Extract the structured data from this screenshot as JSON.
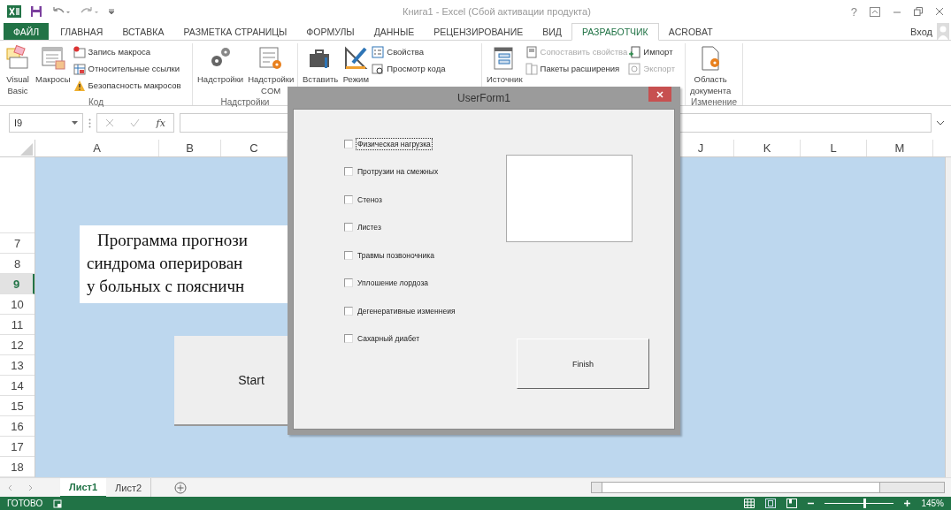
{
  "window": {
    "title": "Книга1 - Excel (Сбой активации продукта)",
    "help": "?"
  },
  "ribbon_tabs": [
    {
      "label": "ФАЙЛ",
      "kind": "file",
      "selected": false
    },
    {
      "label": "ГЛАВНАЯ",
      "kind": "tab",
      "selected": false
    },
    {
      "label": "ВСТАВКА",
      "kind": "tab",
      "selected": false
    },
    {
      "label": "РАЗМЕТКА СТРАНИЦЫ",
      "kind": "tab",
      "selected": false
    },
    {
      "label": "ФОРМУЛЫ",
      "kind": "tab",
      "selected": false
    },
    {
      "label": "ДАННЫЕ",
      "kind": "tab",
      "selected": false
    },
    {
      "label": "РЕЦЕНЗИРОВАНИЕ",
      "kind": "tab",
      "selected": false
    },
    {
      "label": "ВИД",
      "kind": "tab",
      "selected": false
    },
    {
      "label": "РАЗРАБОТЧИК",
      "kind": "tab",
      "selected": true
    },
    {
      "label": "ACROBAT",
      "kind": "tab",
      "selected": false
    }
  ],
  "account": {
    "label": "Вход"
  },
  "ribbon_groups": [
    {
      "label": "Код",
      "items": [
        {
          "kind": "large",
          "label": "Visual Basic",
          "disabled": false
        },
        {
          "kind": "large",
          "label": "Макросы",
          "disabled": false
        },
        {
          "kind": "stack",
          "children": [
            {
              "label": "Запись макроса",
              "disabled": false
            },
            {
              "label": "Относительные ссылки",
              "disabled": false
            },
            {
              "label": "Безопасность макросов",
              "disabled": false
            }
          ]
        }
      ]
    },
    {
      "label": "Надстройки",
      "items": [
        {
          "kind": "large",
          "label": "Надстройки",
          "disabled": false
        },
        {
          "kind": "large",
          "label": "Надстройки COM",
          "disabled": false
        }
      ]
    },
    {
      "items": [
        {
          "kind": "large",
          "label": "Вставить",
          "disabled": false
        },
        {
          "kind": "large",
          "label": "Режим",
          "disabled": false
        },
        {
          "kind": "stack",
          "children": [
            {
              "label": "Свойства",
              "disabled": false
            },
            {
              "label": "Просмотр кода",
              "disabled": false
            }
          ]
        }
      ]
    },
    {
      "items": [
        {
          "kind": "large",
          "label": "Источник",
          "disabled": false
        },
        {
          "kind": "stack",
          "children": [
            {
              "label": "Сопоставить свойства",
              "disabled": true
            },
            {
              "label": "Пакеты расширения",
              "disabled": false
            }
          ]
        },
        {
          "kind": "stack",
          "children": [
            {
              "label": "Импорт",
              "disabled": false
            },
            {
              "label": "Экспорт",
              "disabled": true
            }
          ]
        }
      ]
    },
    {
      "label": "Изменение",
      "items": [
        {
          "kind": "large",
          "label": "Область документа",
          "disabled": false
        }
      ]
    }
  ],
  "formula_bar": {
    "name_box": "I9",
    "function_label": "fx"
  },
  "column_headers": {
    "left": [
      "A",
      "B",
      "C"
    ],
    "right": [
      "J",
      "K",
      "L",
      "M"
    ]
  },
  "rows": [
    {
      "label": "7",
      "selected": false
    },
    {
      "label": "8",
      "selected": false
    },
    {
      "label": "9",
      "selected": true
    },
    {
      "label": "10",
      "selected": false
    },
    {
      "label": "11",
      "selected": false
    },
    {
      "label": "12",
      "selected": false
    },
    {
      "label": "13",
      "selected": false
    },
    {
      "label": "14",
      "selected": false
    },
    {
      "label": "15",
      "selected": false
    },
    {
      "label": "16",
      "selected": false
    },
    {
      "label": "17",
      "selected": false
    },
    {
      "label": "18",
      "selected": false
    }
  ],
  "sheet_text_box": {
    "lines": [
      "Программа прогнози",
      "синдрома оперирован",
      "у больных с поясничн"
    ]
  },
  "start_button": {
    "label": "Start"
  },
  "user_form": {
    "title": "UserForm1",
    "checkboxes": [
      {
        "label": "Физическая нагрузка",
        "checked": false,
        "focused": true
      },
      {
        "label": "Протрузии на смежных",
        "checked": false,
        "focused": false
      },
      {
        "label": "Стеноз",
        "checked": false,
        "focused": false
      },
      {
        "label": "Листез",
        "checked": false,
        "focused": false
      },
      {
        "label": "Травмы позвоночника",
        "checked": false,
        "focused": false
      },
      {
        "label": "Уплошение лордоза",
        "checked": false,
        "focused": false
      },
      {
        "label": "Дегенеративные изменнеия",
        "checked": false,
        "focused": false
      },
      {
        "label": "Сахарный диабет",
        "checked": false,
        "focused": false
      }
    ],
    "finish_button": {
      "label": "Finish"
    }
  },
  "sheet_tabs": [
    {
      "label": "Лист1",
      "selected": true
    },
    {
      "label": "Лист2",
      "selected": false
    }
  ],
  "status_bar": {
    "status": "ГОТОВО",
    "zoom": {
      "level": 0.56,
      "reading": "145%"
    }
  }
}
